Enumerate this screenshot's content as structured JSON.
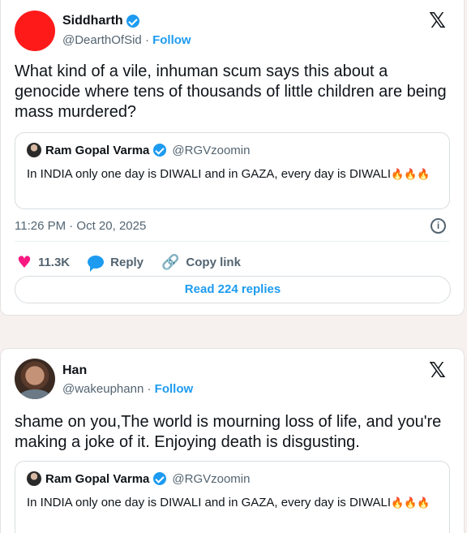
{
  "tweet1": {
    "name": "Siddharth",
    "handle": "@DearthOfSid",
    "separator": "·",
    "follow": "Follow",
    "text": "What kind of a vile, inhuman scum says this about a genocide where tens of thousands of little children are being mass murdered?",
    "quote": {
      "name": "Ram Gopal Varma",
      "handle": "@RGVzoomin",
      "text": "In INDIA only one day is DIWALI and in GAZA, every day is DIWALI",
      "emoji": "🔥🔥🔥"
    },
    "timestamp": "11:26 PM · Oct 20, 2025",
    "likes": "11.3K",
    "reply_label": "Reply",
    "copy_link_label": "Copy link",
    "read_replies": "Read 224 replies"
  },
  "tweet2": {
    "name": "Han",
    "handle": "@wakeuphann",
    "separator": "·",
    "follow": "Follow",
    "text": "shame on you,The world is mourning loss of life, and you're making a joke of it. Enjoying death is disgusting.",
    "quote": {
      "name": "Ram Gopal Varma",
      "handle": "@RGVzoomin",
      "text": "In INDIA only one day is DIWALI and in GAZA, every day is DIWALI",
      "emoji": "🔥🔥🔥"
    }
  },
  "icons": {
    "x_logo": "𝕏",
    "heart": "♥",
    "link": "🔗",
    "info": "i",
    "verified": "verified-badge"
  },
  "colors": {
    "accent": "#1d9bf0",
    "heart": "#f91880",
    "secondary_text": "#536471"
  }
}
